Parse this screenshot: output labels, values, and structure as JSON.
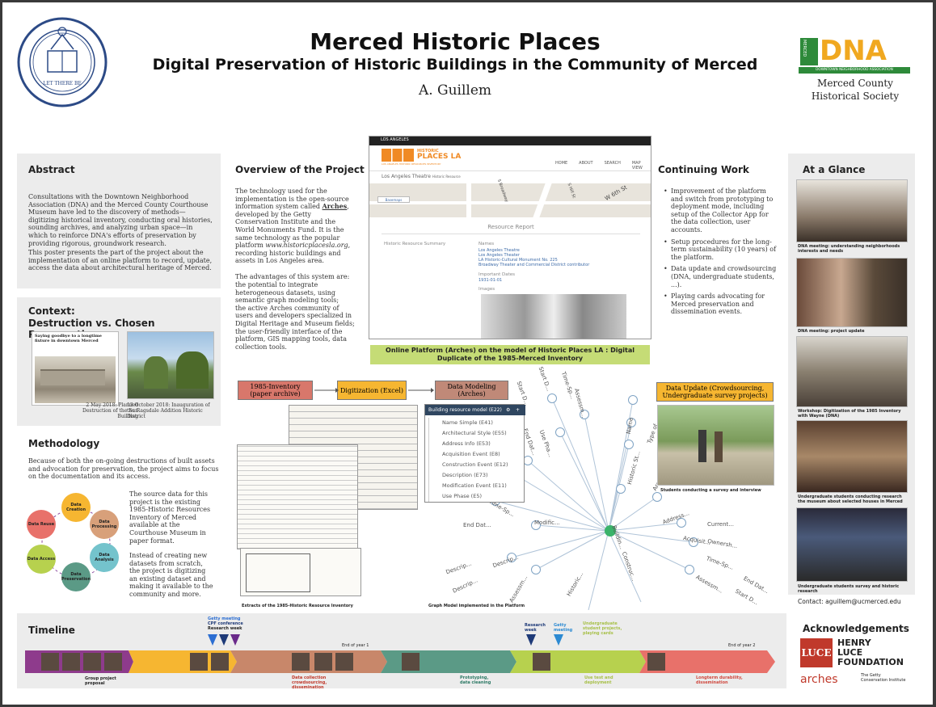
{
  "header": {
    "title": "Merced Historic Places",
    "subtitle": "Digital Preservation of Historic Buildings in the Community of Merced",
    "author": "A. Guillem",
    "society_line1": "Merced County",
    "society_line2": "Historical Society",
    "dna_logo_text": "DNA",
    "dna_logo_small": "MERCED",
    "dna_logo_banner": "DOWNTOWN NEIGHBORHOOD ASSOCIATION",
    "seal_text": "THE UNIVERSITY OF CALIFORNIA · MERCED ·"
  },
  "abstract": {
    "heading": "Abstract",
    "p1": "Consultations with the Downtown Neighborhood Association (DNA) and the Merced County Courthouse Museum have led to the discovery of methods—digitizing historical inventory, conducting oral histories, sounding archives, and analyzing urban space—in which to reinforce DNA's efforts of preservation by providing rigorous, groundwork research.",
    "p2": "This poster presents the part of the project about the implementation of an online platform to record, update, access the data about architectural heritage of Merced."
  },
  "context": {
    "heading1": "Context:",
    "heading2": "Destruction vs. Chosen Preservation",
    "newspaper_headline": "Saying goodbye to a longtime fixture in downtown Merced",
    "cap1": "2 May 2018: Planned Destruction of the Sun Building",
    "cap2": "13 October 2018: Inauguration of the Ragsdale Addition Historic District"
  },
  "methodology": {
    "heading": "Methodology",
    "p1": "Because of both the on-going destructions of built assets and advocation for preservation, the project aims to focus on the documentation and its access.",
    "p2": "The source data for this project is the existing 1985-Historic Resources Inventory of Merced available at the Courthouse Museum in paper format.",
    "p3": "Instead of creating new datasets from scratch,  the project is digitizing an existing dataset and making it available to the community and more.",
    "cycle": [
      "Data Creation",
      "Data Processing",
      "Data Analysis",
      "Data Preservation",
      "Data Access",
      "Data Reuse"
    ]
  },
  "overview": {
    "heading": "Overview of the Project",
    "p1a": "The technology used for the implementation is the open-source information system called ",
    "p1b": "Arches",
    "p1c": ", developed by the Getty Conservation Institute and the World Monuments Fund. It is the same technology as the popular platform ",
    "p1d": "www.historicplacesla.org",
    "p1e": ", recording historic buildings and assets in Los Angeles area.",
    "p2": "The advantages of this system are:",
    "list": [
      "the potential to integrate heterogeneous datasets, using semantic graph modeling tools;",
      "the active Arches community of users and developers specialized in Digital Heritage and Museum fields;",
      "the user-friendly interface of the platform, GIS mapping tools, data collection tools."
    ]
  },
  "screenshot": {
    "topbar": "LOS ANGELES",
    "logo_small": "HISTORIC",
    "logo_big": "PLACES LA",
    "tagline": "LOS ANGELES HISTORIC RESOURCES INVENTORY",
    "nav": [
      "HOME",
      "ABOUT",
      "SEARCH",
      "MAP VIEW"
    ],
    "breadcrumb": "Los Angeles Theatre",
    "breadcrumb2": "Historic Resource",
    "basemaps": "Basemaps",
    "report_title": "Resource Report",
    "section": "Historic Resource Summary",
    "names_label": "Names",
    "names": [
      "Los Angeles Theatre",
      "Los Angeles Theater",
      "LA Historic-Cultural Monument No. 225",
      "Broadway Theater and Commercial District contributor"
    ],
    "dates_label": "Important Dates",
    "date": "1931-01-01",
    "images_label": "Images",
    "streets": [
      "S Broadway",
      "S Hill St",
      "W 6th St"
    ]
  },
  "screenshot_caption": "Online Platform (Arches) on the model of Historic Places LA : Digital Duplicate of the 1985-Merced Inventory",
  "flow": {
    "inventory": "1985-Inventory (paper archive)",
    "digitization": "Digitization (Excel)",
    "modeling": "Data Modeling (Arches)",
    "update": "Data Update (Crowdsourcing, Undergraduate survey projects)"
  },
  "inventory_caption": "Extracts of the 1985-Historic Resource Inventory",
  "graph": {
    "panel_title": "Building resource model (E22)",
    "items": [
      "Name Simple (E41)",
      "Architectural Style (E55)",
      "Address Info (E53)",
      "Acquisition Event (E8)",
      "Construction Event (E12)",
      "Description (E73)",
      "Modification Event (E11)",
      "Use Phase (E5)"
    ],
    "caption": "Graph Model implemented in the Platform",
    "labels": [
      "Start D...",
      "Time-Sp...",
      "Start D...",
      "Assessm...",
      "Name",
      "Type of...",
      "End Dat...",
      "Use Pha...",
      "Historic St...",
      "Arc...",
      "Time-Sp...",
      "End Dat...",
      "Modific...",
      "Address...",
      "Current...",
      "Acquisit...",
      "Ownersh...",
      "Time-Sp...",
      "Descrip...",
      "Descrip...",
      "Descrip...",
      "Assessm...",
      "Construc...",
      "Historic...",
      "Assessm...",
      "End Dat...",
      "Start D...",
      "Buildin..."
    ]
  },
  "survey_caption": "Students conducting a survey and interview",
  "continuing": {
    "heading": "Continuing Work",
    "list": [
      "Improvement of the platform and switch from prototyping to deployment mode, including setup of the Collector App for the data collection, user accounts.",
      "Setup procedures for the long-term sustainability (10 years) of the platform.",
      "Data update and crowdsourcing (DNA, undergraduate students, ...).",
      "Playing cards advocating for Merced preservation and dissemination events."
    ]
  },
  "glance": {
    "heading": "At a Glance",
    "captions": [
      "DNA meeting: understanding neighborhoods interests and needs",
      "DNA meeting: project update",
      "Workshop: Digitization of the 1985 Inventory with Wayne (DNA)",
      "Undergraduate students conducting research the museum about selected houses in Merced",
      "Undergraduate students survey and historic research"
    ],
    "contact": "Contact: aguillem@ucmerced.edu"
  },
  "timeline": {
    "heading": "Timeline",
    "markers": [
      "Getty meeting",
      "CPF conference",
      "Research week",
      "Research week",
      "Getty meeting",
      "Undergraduate student projects, playing cards"
    ],
    "end1": "End of year 1",
    "end2": "End of year 2",
    "phases": [
      "Group project proposal",
      "Data collection crowdsourcing, dissemination",
      "Prototyping, data cleaning",
      "Use test and deployment",
      "Longterm durability, dissemination"
    ]
  },
  "ack": {
    "heading": "Acknowledgements",
    "luce1": "HENRY",
    "luce2": "LUCE",
    "luce3": "FOUNDATION",
    "luce_mark": "LUCE",
    "arches": "arches",
    "getty1": "The Getty",
    "getty2": "Conservation Institute"
  }
}
